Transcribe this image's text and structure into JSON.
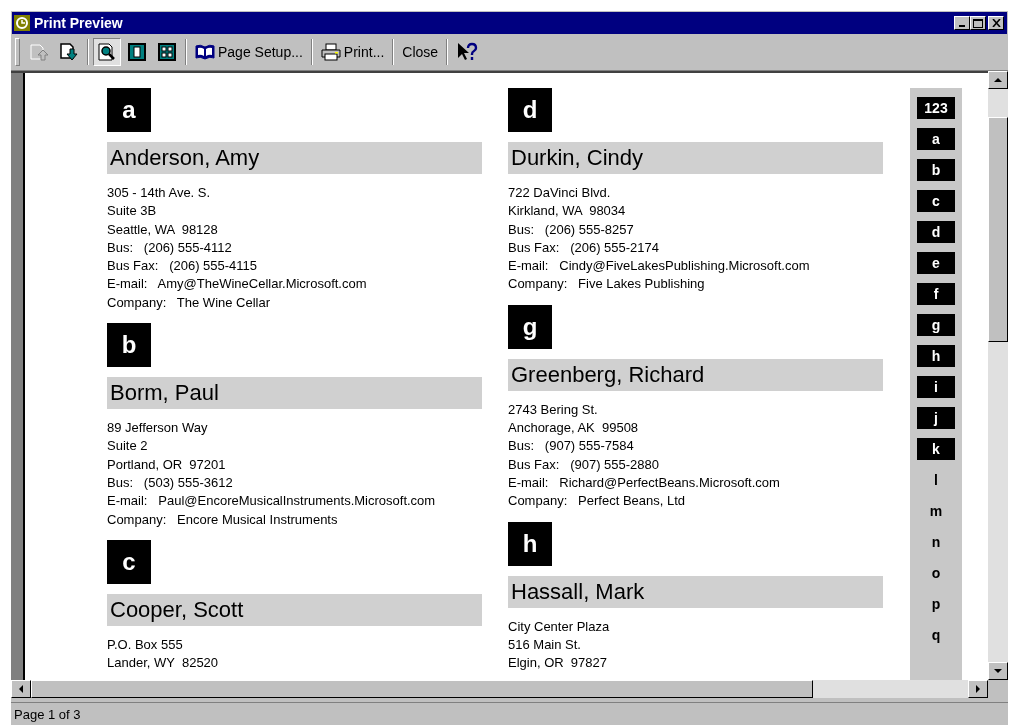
{
  "window": {
    "title": "Print Preview"
  },
  "toolbar": {
    "previous_page": {
      "disabled": true
    },
    "next_page": {
      "disabled": false
    },
    "zoom": {
      "pressed": true
    },
    "one_page": {
      "pressed": false
    },
    "multiple_pages": {
      "pressed": false
    },
    "page_setup": {
      "label": "Page Setup..."
    },
    "print": {
      "label": "Print..."
    },
    "close": {
      "label": "Close"
    }
  },
  "columns": [
    {
      "sections": [
        {
          "letter": "a",
          "contacts": [
            {
              "name": "Anderson, Amy",
              "lines": [
                "305 - 14th Ave. S.",
                "Suite 3B",
                "Seattle, WA  98128",
                "Bus:   (206) 555-4112",
                "Bus Fax:   (206) 555-4115",
                "E-mail:   Amy@TheWineCellar.Microsoft.com",
                "Company:   The Wine Cellar"
              ]
            }
          ]
        },
        {
          "letter": "b",
          "contacts": [
            {
              "name": "Borm, Paul",
              "lines": [
                "89 Jefferson Way",
                "Suite 2",
                "Portland, OR  97201",
                "Bus:   (503) 555-3612",
                "E-mail:   Paul@EncoreMusicalInstruments.Microsoft.com",
                "Company:   Encore Musical Instruments"
              ]
            }
          ]
        },
        {
          "letter": "c",
          "contacts": [
            {
              "name": "Cooper, Scott",
              "lines": [
                "P.O. Box 555",
                "Lander, WY  82520"
              ]
            }
          ]
        }
      ]
    },
    {
      "sections": [
        {
          "letter": "d",
          "contacts": [
            {
              "name": "Durkin, Cindy",
              "lines": [
                "722 DaVinci Blvd.",
                "Kirkland, WA  98034",
                "Bus:   (206) 555-8257",
                "Bus Fax:   (206) 555-2174",
                "E-mail:   Cindy@FiveLakesPublishing.Microsoft.com",
                "Company:   Five Lakes Publishing"
              ]
            }
          ]
        },
        {
          "letter": "g",
          "contacts": [
            {
              "name": "Greenberg, Richard",
              "lines": [
                "2743 Bering St.",
                "Anchorage, AK  99508",
                "Bus:   (907) 555-7584",
                "Bus Fax:   (907) 555-2880",
                "E-mail:   Richard@PerfectBeans.Microsoft.com",
                "Company:   Perfect Beans, Ltd"
              ]
            }
          ]
        },
        {
          "letter": "h",
          "contacts": [
            {
              "name": "Hassall, Mark",
              "lines": [
                "City Center Plaza",
                "516 Main St.",
                "Elgin, OR  97827"
              ]
            }
          ]
        }
      ]
    }
  ],
  "index_tabs": [
    {
      "label": "123",
      "highlighted": true
    },
    {
      "label": "a",
      "highlighted": true
    },
    {
      "label": "b",
      "highlighted": true
    },
    {
      "label": "c",
      "highlighted": true
    },
    {
      "label": "d",
      "highlighted": true
    },
    {
      "label": "e",
      "highlighted": true
    },
    {
      "label": "f",
      "highlighted": true
    },
    {
      "label": "g",
      "highlighted": true
    },
    {
      "label": "h",
      "highlighted": true
    },
    {
      "label": "i",
      "highlighted": true
    },
    {
      "label": "j",
      "highlighted": true
    },
    {
      "label": "k",
      "highlighted": true
    },
    {
      "label": "l",
      "highlighted": false
    },
    {
      "label": "m",
      "highlighted": false
    },
    {
      "label": "n",
      "highlighted": false
    },
    {
      "label": "o",
      "highlighted": false
    },
    {
      "label": "p",
      "highlighted": false
    },
    {
      "label": "q",
      "highlighted": false
    }
  ],
  "status_bar": {
    "text": "Page 1 of 3"
  }
}
